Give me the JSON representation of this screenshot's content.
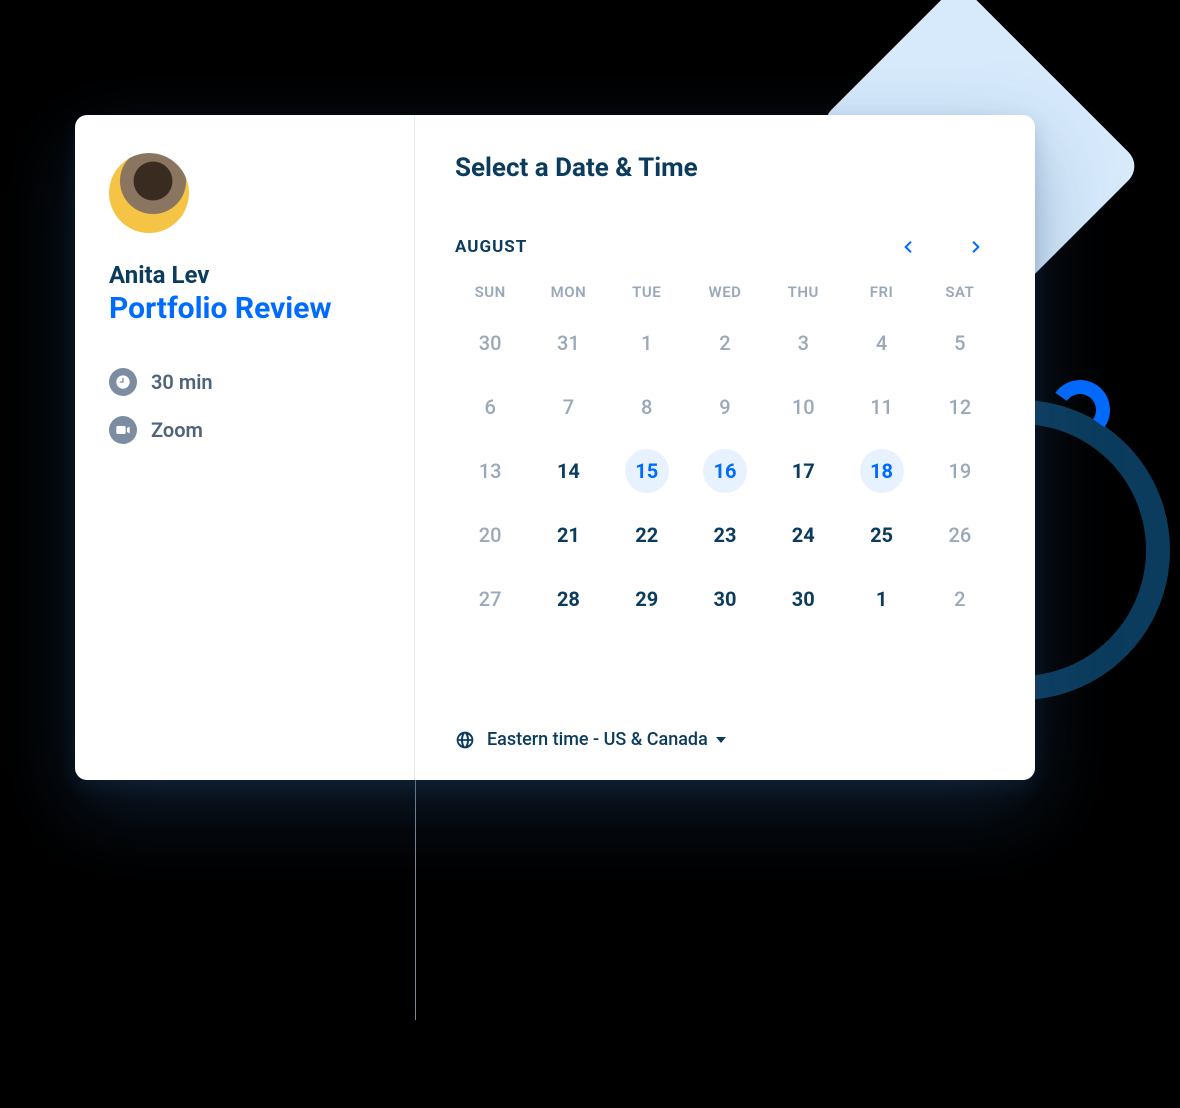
{
  "host": {
    "name": "Anita Lev"
  },
  "event": {
    "title": "Portfolio Review",
    "duration_label": "30 min",
    "location_label": "Zoom"
  },
  "scheduler": {
    "heading": "Select a Date & Time",
    "month_label": "AUGUST",
    "dow": [
      "SUN",
      "MON",
      "TUE",
      "WED",
      "THU",
      "FRI",
      "SAT"
    ],
    "weeks": [
      [
        {
          "n": "30",
          "state": "muted"
        },
        {
          "n": "31",
          "state": "muted"
        },
        {
          "n": "1",
          "state": "muted"
        },
        {
          "n": "2",
          "state": "muted"
        },
        {
          "n": "3",
          "state": "muted"
        },
        {
          "n": "4",
          "state": "muted"
        },
        {
          "n": "5",
          "state": "muted"
        }
      ],
      [
        {
          "n": "6",
          "state": "muted"
        },
        {
          "n": "7",
          "state": "muted"
        },
        {
          "n": "8",
          "state": "muted"
        },
        {
          "n": "9",
          "state": "muted"
        },
        {
          "n": "10",
          "state": "muted"
        },
        {
          "n": "11",
          "state": "muted"
        },
        {
          "n": "12",
          "state": "muted"
        }
      ],
      [
        {
          "n": "13",
          "state": "muted"
        },
        {
          "n": "14",
          "state": "bold"
        },
        {
          "n": "15",
          "state": "avail"
        },
        {
          "n": "16",
          "state": "avail"
        },
        {
          "n": "17",
          "state": "bold"
        },
        {
          "n": "18",
          "state": "avail"
        },
        {
          "n": "19",
          "state": "muted"
        }
      ],
      [
        {
          "n": "20",
          "state": "muted"
        },
        {
          "n": "21",
          "state": "bold"
        },
        {
          "n": "22",
          "state": "bold"
        },
        {
          "n": "23",
          "state": "bold"
        },
        {
          "n": "24",
          "state": "bold"
        },
        {
          "n": "25",
          "state": "bold"
        },
        {
          "n": "26",
          "state": "muted"
        }
      ],
      [
        {
          "n": "27",
          "state": "muted"
        },
        {
          "n": "28",
          "state": "bold"
        },
        {
          "n": "29",
          "state": "bold"
        },
        {
          "n": "30",
          "state": "bold"
        },
        {
          "n": "30",
          "state": "bold"
        },
        {
          "n": "1",
          "state": "bold"
        },
        {
          "n": "2",
          "state": "muted"
        }
      ]
    ],
    "timezone_label": "Eastern time - US & Canada"
  }
}
